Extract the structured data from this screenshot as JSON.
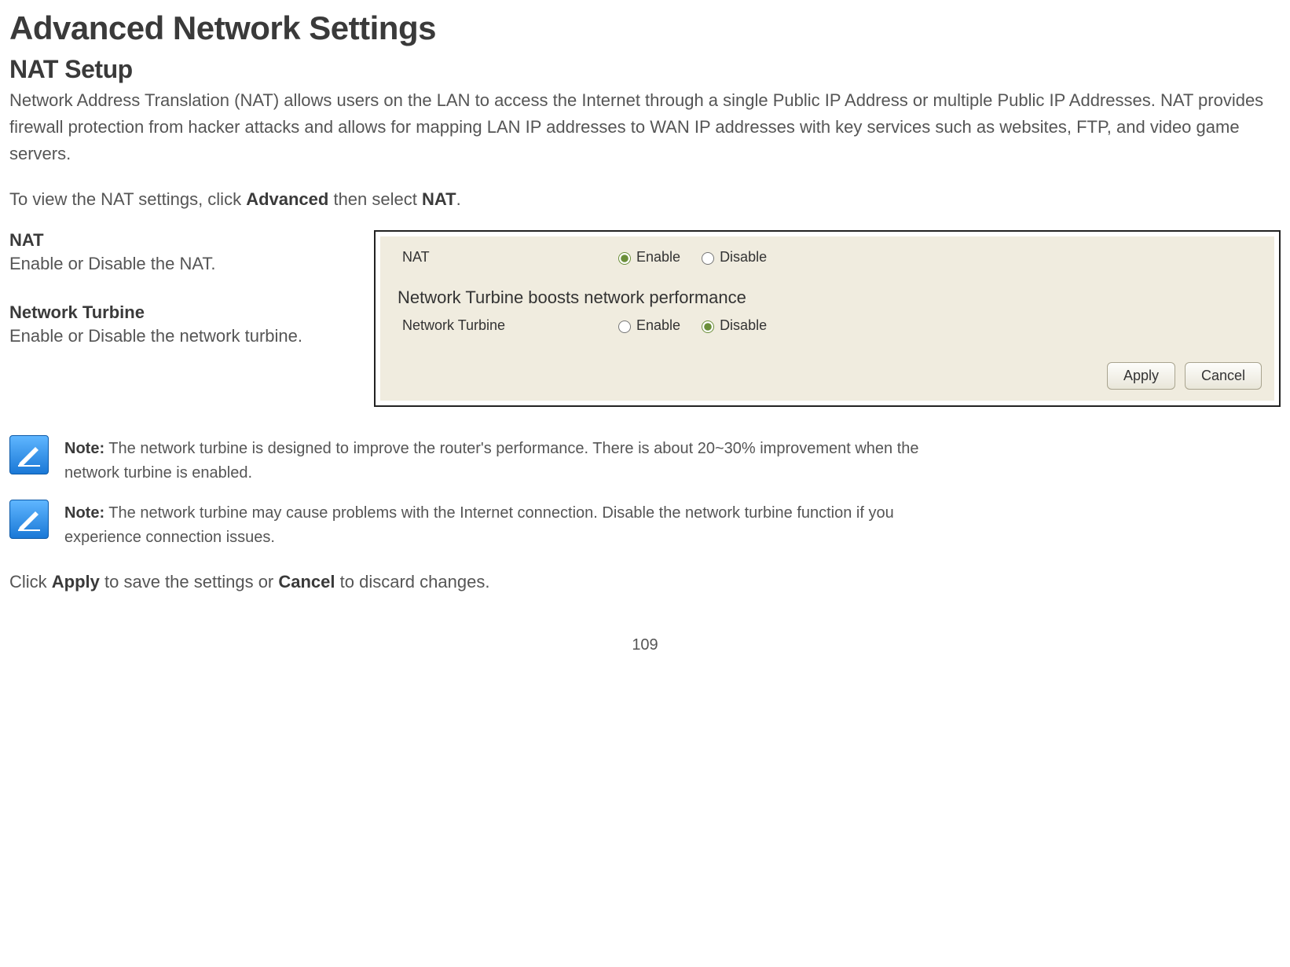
{
  "page": {
    "title": "Advanced Network Settings",
    "section": "NAT Setup",
    "intro": "Network Address Translation (NAT) allows users on the LAN to access the Internet through a single Public IP Address or multiple Public IP Addresses. NAT provides firewall protection from hacker attacks and allows for mapping LAN IP addresses to WAN IP addresses with key services such as websites, FTP, and video game servers.",
    "nav_prefix": "To view the NAT settings, click ",
    "nav_b1": "Advanced",
    "nav_mid": " then select ",
    "nav_b2": "NAT",
    "nav_suffix": ".",
    "number": "109"
  },
  "desc": {
    "nat_title": "NAT",
    "nat_text": "Enable or Disable the NAT.",
    "turbine_title": "Network Turbine",
    "turbine_text": "Enable or Disable the network turbine."
  },
  "panel": {
    "nat_label": "NAT",
    "enable": "Enable",
    "disable": "Disable",
    "subhead": "Network Turbine boosts network performance",
    "turbine_label": "Network Turbine",
    "apply": "Apply",
    "cancel": "Cancel",
    "nat_selected": "enable",
    "turbine_selected": "disable"
  },
  "notes": {
    "label": "Note:",
    "n1": " The network turbine is designed to improve the router's performance. There is about 20~30% improvement when the network turbine is enabled.",
    "n2": " The network turbine may cause problems with the Internet connection. Disable the network turbine function if you experience connection issues."
  },
  "closing": {
    "prefix": "Click ",
    "b1": "Apply",
    "mid": " to save the settings or ",
    "b2": "Cancel",
    "suffix": " to discard changes."
  }
}
